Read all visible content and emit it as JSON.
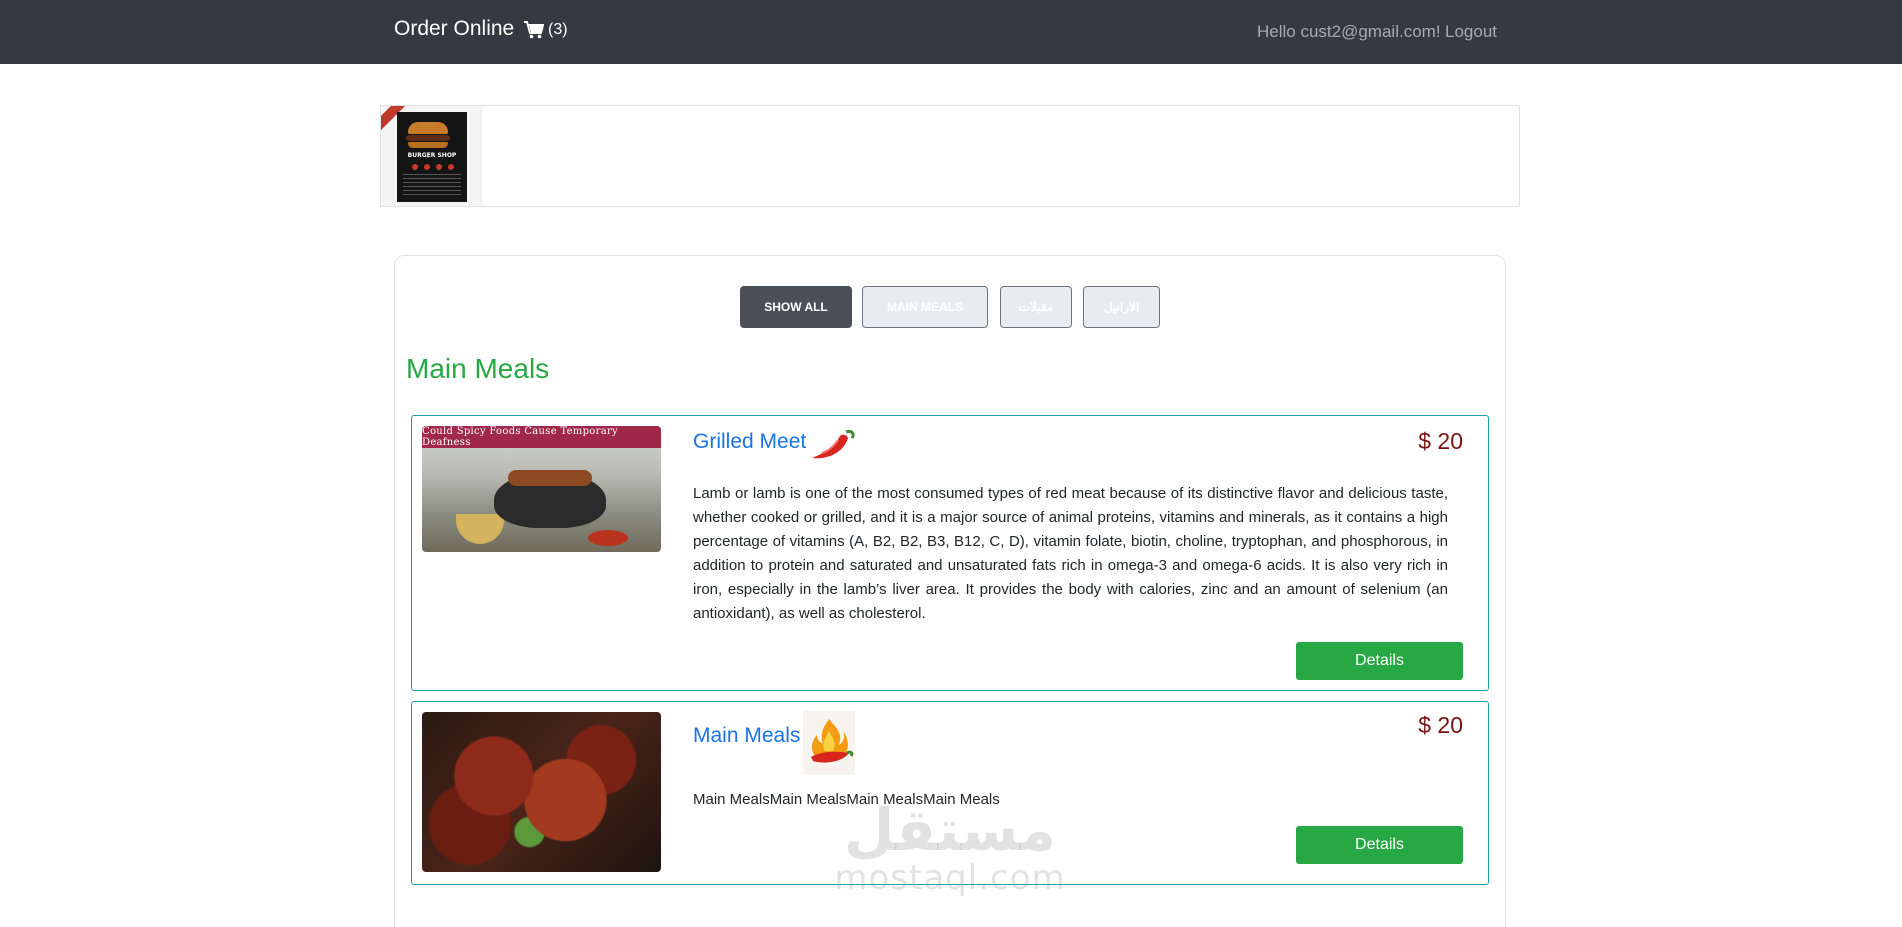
{
  "navbar": {
    "brand": "Order Online",
    "cart_icon": "shopping-cart-icon",
    "cart_count": "(3)",
    "greeting": "Hello cust2@gmail.com!",
    "logout": "Logout"
  },
  "banner": {
    "poster_icon": "burger-shop-poster",
    "poster_title": "BURGER SHOP"
  },
  "filters": [
    {
      "label": "SHOW ALL",
      "active": true
    },
    {
      "label": "MAIN MEALS",
      "active": false
    },
    {
      "label": "مقبلات",
      "active": false
    },
    {
      "label": "الارانيل",
      "active": false
    }
  ],
  "section": {
    "title": "Main Meals"
  },
  "items": [
    {
      "name": "Grilled Meet",
      "price": "$ 20",
      "icon": "chili-pepper-icon",
      "image_caption": "Could Spicy Foods Cause Temporary Deafness",
      "description": "Lamb or lamb is one of the most consumed types of red meat because of its distinctive flavor and delicious taste, whether cooked or grilled, and it is a major source of animal proteins, vitamins and minerals, as it contains a high percentage of vitamins (A, B2, B2, B3, B12, C, D), vitamin folate, biotin, choline, tryptophan, and phosphorous, in addition to protein and saturated and unsaturated fats rich in omega-3 and omega-6 acids. It is also very rich in iron, especially in the lamb’s liver area. It provides the body with calories, zinc and an amount of selenium (an antioxidant), as well as cholesterol.",
      "button": "Details"
    },
    {
      "name": "Main Meals",
      "price": "$ 20",
      "icon": "flaming-chili-icon",
      "description": "Main MealsMain MealsMain MealsMain Meals",
      "button": "Details"
    }
  ],
  "watermark": {
    "arabic": "مستقل",
    "latin": "mostaql.com"
  },
  "colors": {
    "navbar": "#343a40",
    "accent_green": "#28a745",
    "link_blue": "#1a73e8",
    "price_red": "#7a1212",
    "card_border": "#17a2b8"
  }
}
